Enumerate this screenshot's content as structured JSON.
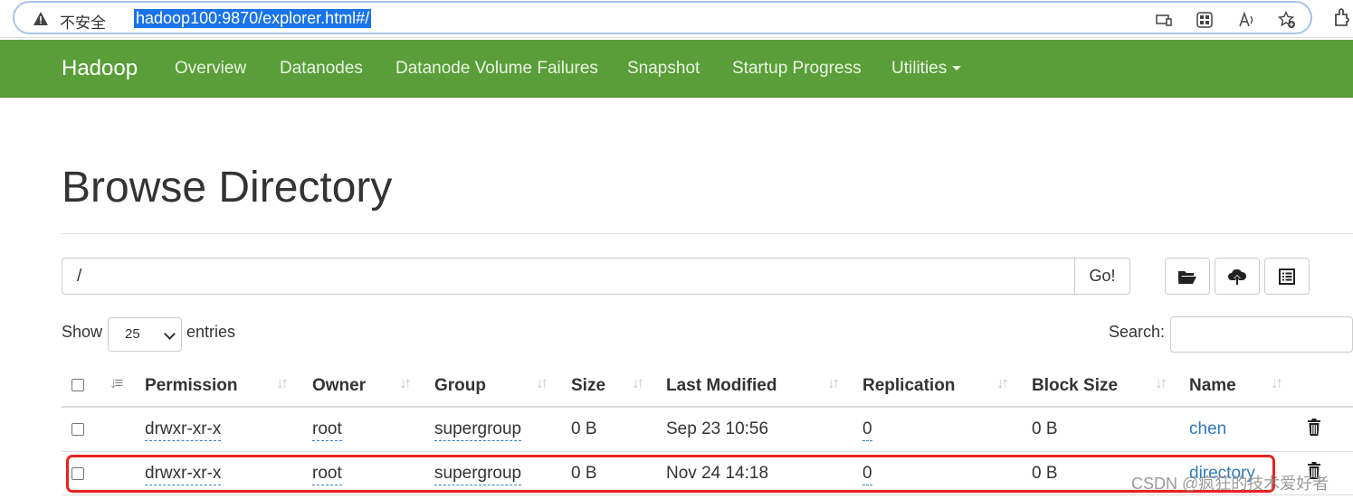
{
  "browser": {
    "insecure_label": "不安全",
    "url": "hadoop100:9870/explorer.html#/"
  },
  "navbar": {
    "brand": "Hadoop",
    "items": [
      "Overview",
      "Datanodes",
      "Datanode Volume Failures",
      "Snapshot",
      "Startup Progress",
      "Utilities"
    ]
  },
  "page": {
    "title": "Browse Directory",
    "path_value": "/",
    "go_label": "Go!",
    "show_label": "Show",
    "entries_value": "25",
    "entries_label": "entries",
    "search_label": "Search:"
  },
  "table": {
    "headers": [
      "Permission",
      "Owner",
      "Group",
      "Size",
      "Last Modified",
      "Replication",
      "Block Size",
      "Name"
    ],
    "rows": [
      {
        "permission": "drwxr-xr-x",
        "owner": "root",
        "group": "supergroup",
        "size": "0 B",
        "modified": "Sep 23 10:56",
        "replication": "0",
        "block_size": "0 B",
        "name": "chen"
      },
      {
        "permission": "drwxr-xr-x",
        "owner": "root",
        "group": "supergroup",
        "size": "0 B",
        "modified": "Nov 24 14:18",
        "replication": "0",
        "block_size": "0 B",
        "name": "directory"
      }
    ]
  },
  "watermark": "CSDN @疯狂的技术爱好者",
  "colors": {
    "navbar": "#5a9e39",
    "link": "#337ab7",
    "highlight": "#e8231f"
  }
}
